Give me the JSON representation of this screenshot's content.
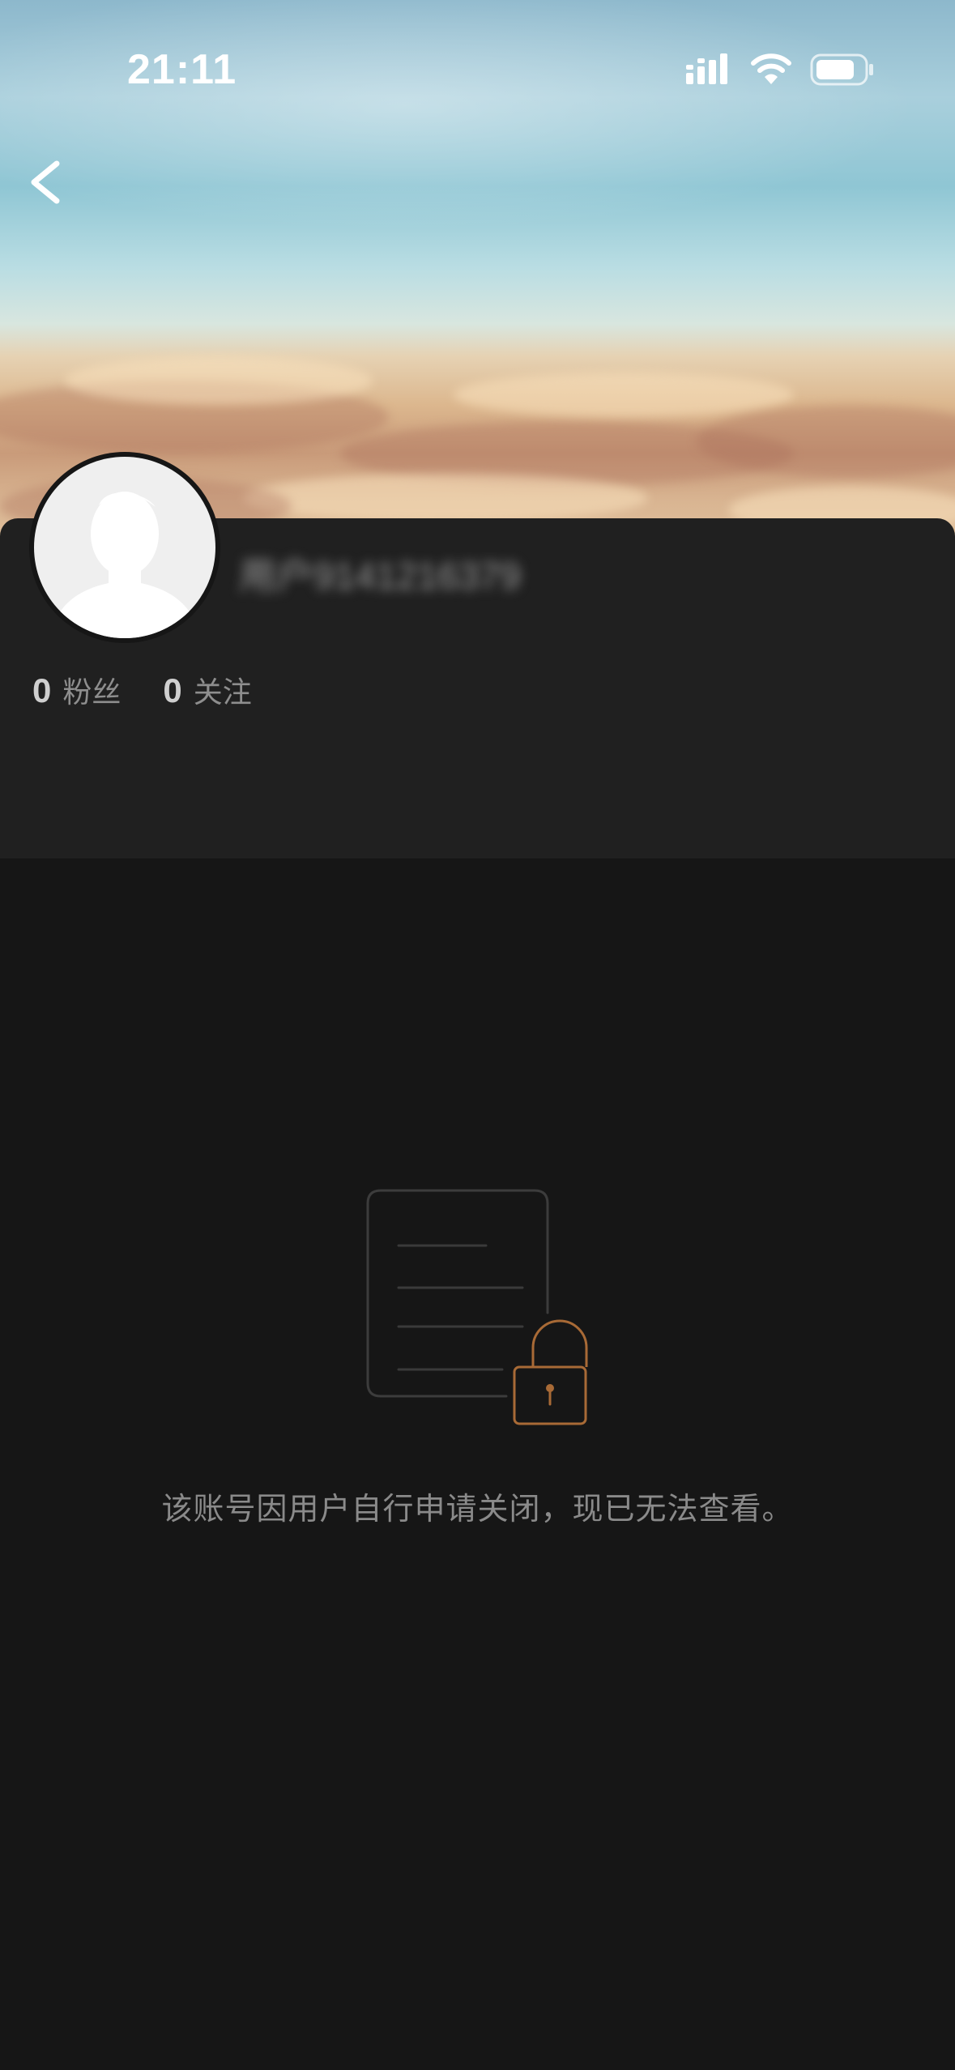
{
  "status_bar": {
    "time": "21:11",
    "icons": [
      "signal-icon",
      "wifi-icon",
      "battery-icon"
    ]
  },
  "header": {
    "back_icon": "chevron-left-icon"
  },
  "profile": {
    "username": "用户9141216379",
    "avatar_icon": "default-avatar-icon",
    "stats": [
      {
        "count": "0",
        "label": "粉丝"
      },
      {
        "count": "0",
        "label": "关注"
      }
    ]
  },
  "closed_state": {
    "icon": "locked-document-icon",
    "message": "该账号因用户自行申请关闭，现已无法查看。",
    "lock_color": "#a86a36"
  },
  "colors": {
    "page_background": "#161616",
    "card_background": "#202020"
  }
}
